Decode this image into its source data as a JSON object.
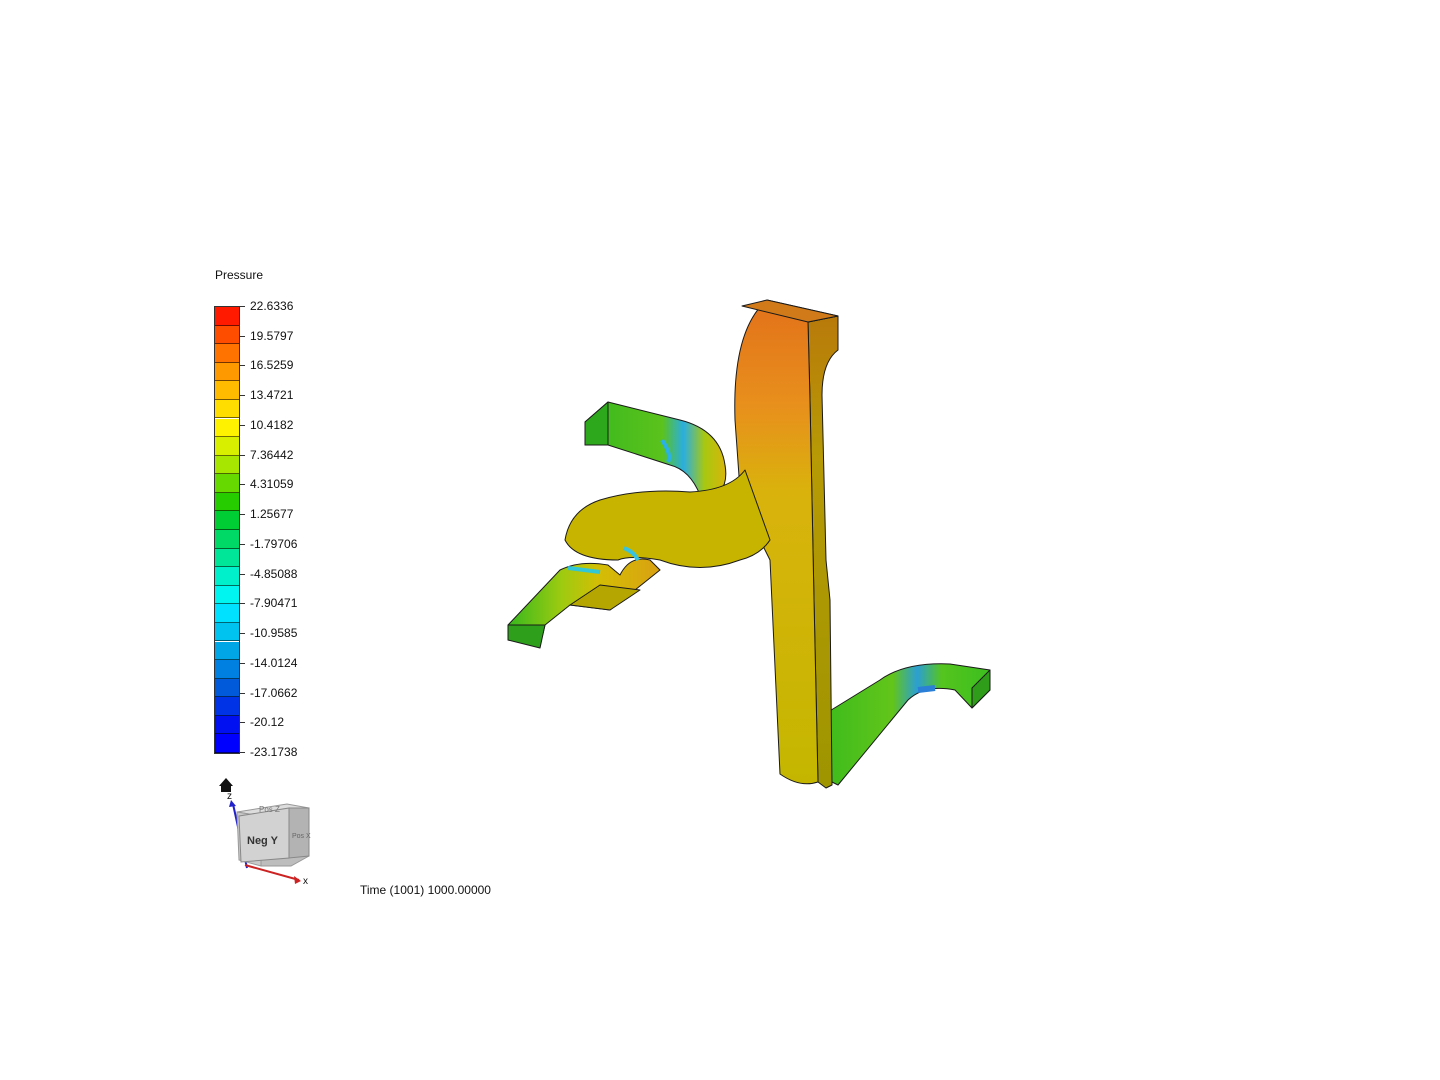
{
  "legend": {
    "title": "Pressure",
    "ticks": [
      "22.6336",
      "19.5797",
      "16.5259",
      "13.4721",
      "10.4182",
      "7.36442",
      "4.31059",
      "1.25677",
      "-1.79706",
      "-4.85088",
      "-7.90471",
      "-10.9585",
      "-14.0124",
      "-17.0662",
      "-20.12",
      "-23.1738"
    ],
    "band_colors": [
      "#ff1a00",
      "#ff4d00",
      "#ff7300",
      "#ff9900",
      "#ffbb00",
      "#ffdd00",
      "#fff200",
      "#d8f000",
      "#a6e600",
      "#66d900",
      "#26cc00",
      "#00cc33",
      "#00d966",
      "#00e699",
      "#00f0cc",
      "#00f5f0",
      "#00e0ff",
      "#00c3f0",
      "#00a6e6",
      "#0080e0",
      "#005ad9",
      "#0033e6",
      "#0010f0",
      "#0000ff"
    ]
  },
  "orientation_cube": {
    "front_label": "Neg Y",
    "top_label": "Pos Z",
    "side_label": "Pos X",
    "x_axis_label": "x",
    "z_axis_label": "z"
  },
  "status": {
    "time_text": "Time (1001) 1000.00000"
  },
  "colors": {
    "outline": "#1a1a1a",
    "inlet_green": "#3fbf1f",
    "main_yellow": "#c9b800",
    "hot_orange": "#e8861a"
  }
}
